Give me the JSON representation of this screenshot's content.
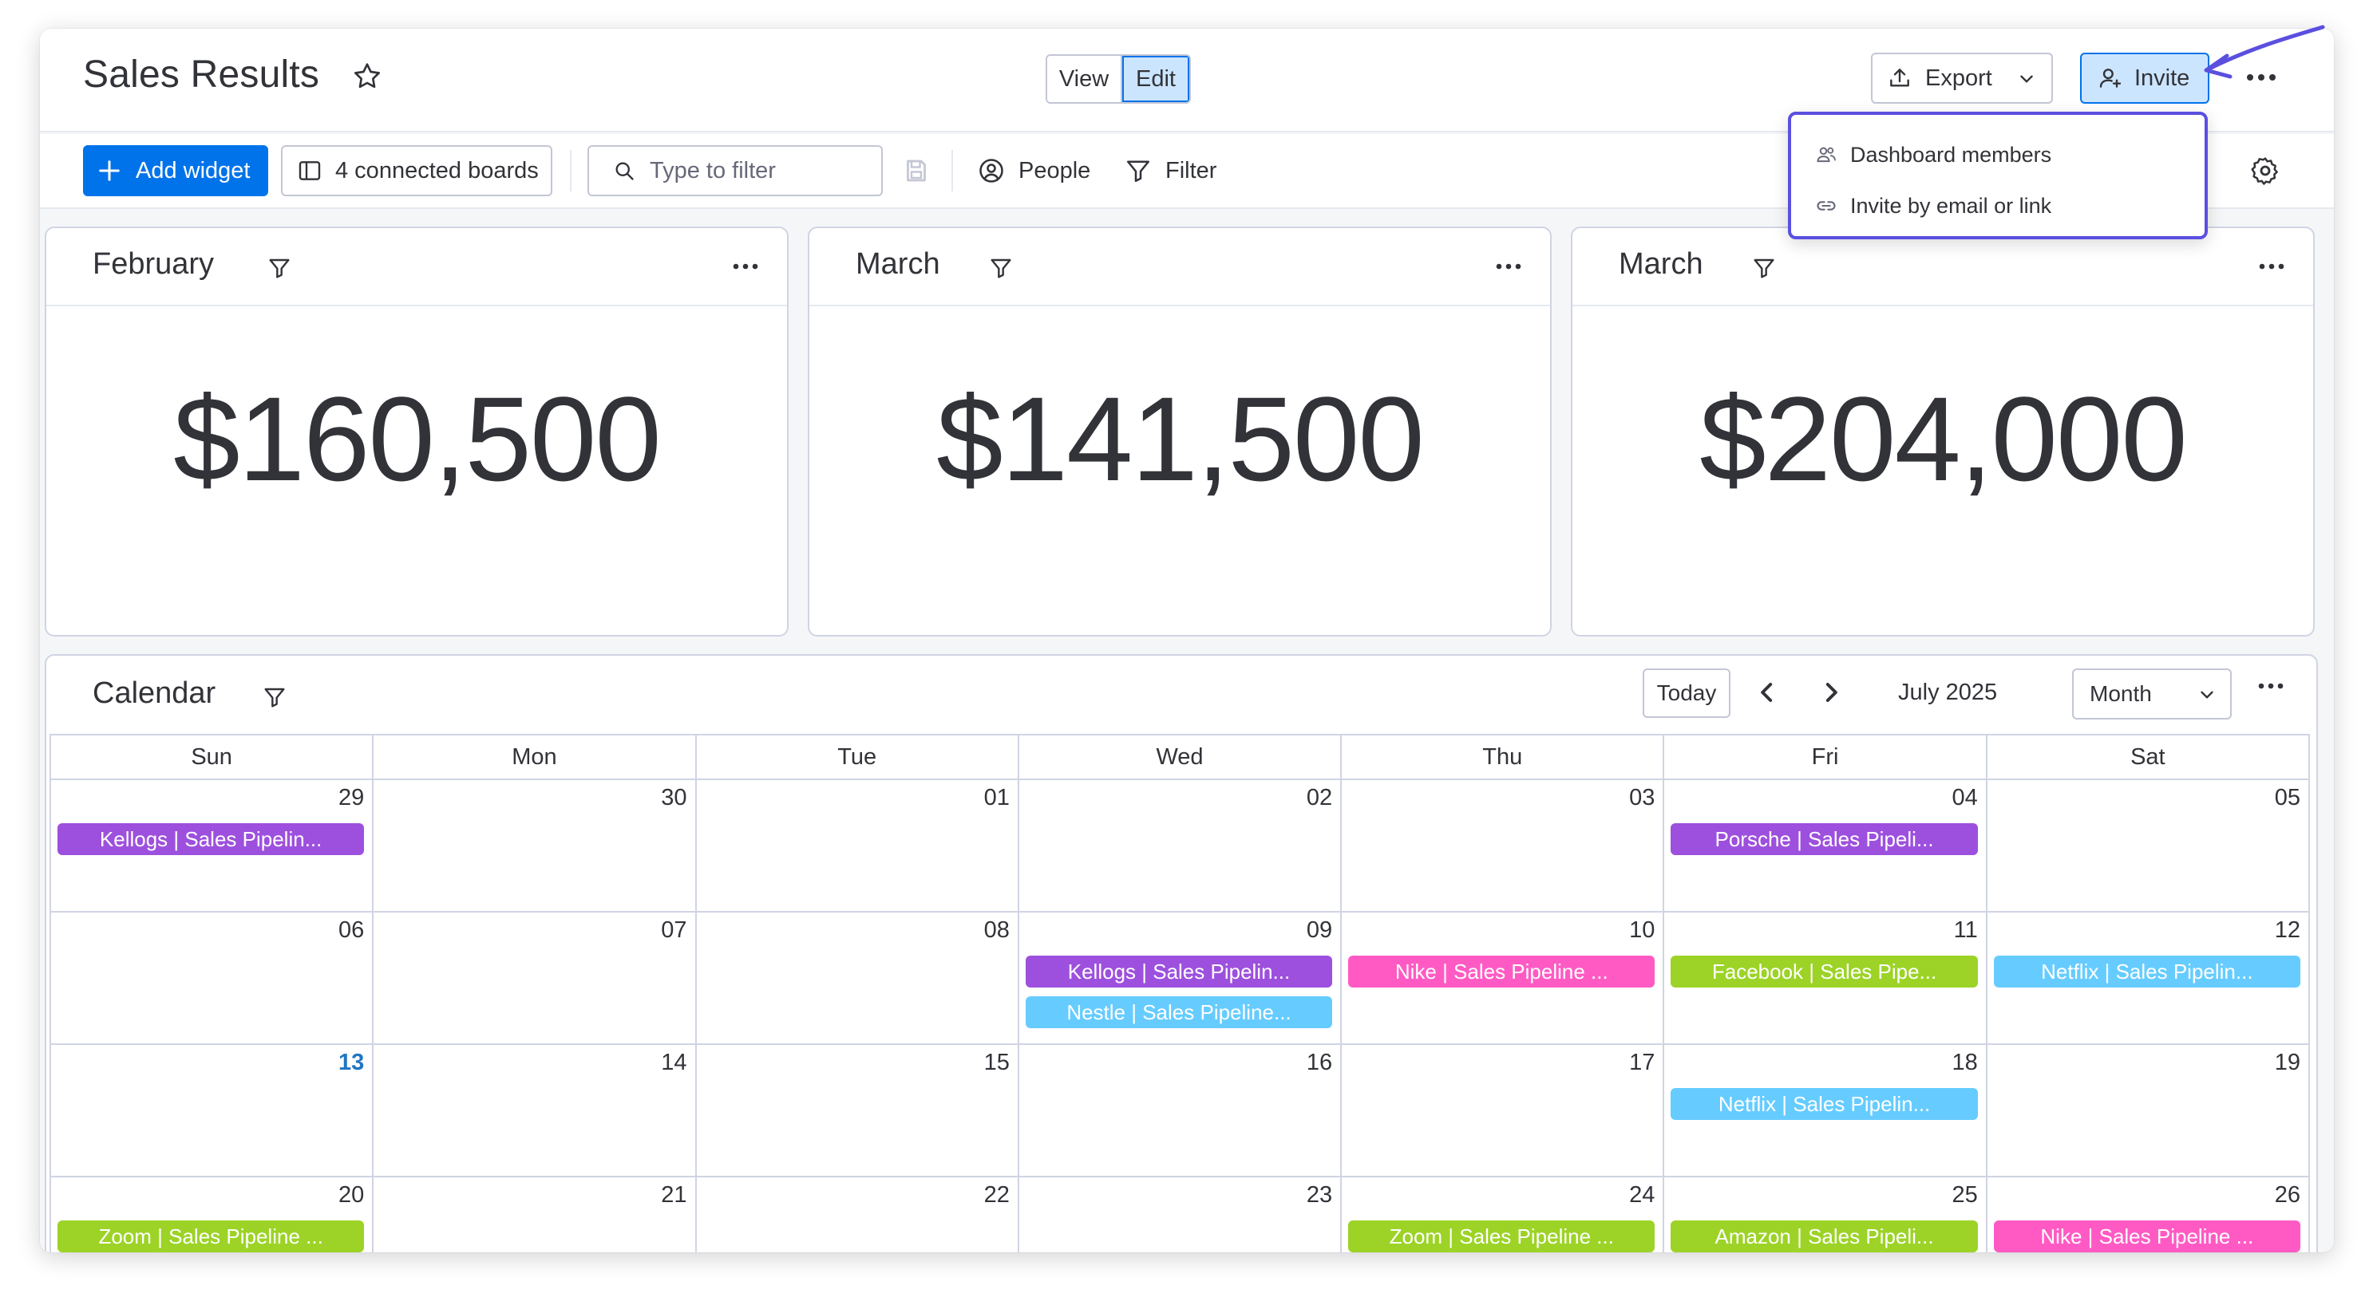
{
  "header": {
    "title": "Sales Results",
    "view_label": "View",
    "edit_label": "Edit",
    "export_label": "Export",
    "invite_label": "Invite"
  },
  "toolbar": {
    "add_widget_label": "Add widget",
    "connected_boards_label": "4 connected boards",
    "filter_placeholder": "Type to filter",
    "people_label": "People",
    "filter_label": "Filter"
  },
  "invite_menu": {
    "items": [
      {
        "label": "Dashboard members",
        "icon": "members-icon"
      },
      {
        "label": "Invite by email or link",
        "icon": "link-icon"
      }
    ]
  },
  "cards": [
    {
      "title": "February",
      "value": "$160,500"
    },
    {
      "title": "March",
      "value": "$141,500"
    },
    {
      "title": "March",
      "value": "$204,000"
    }
  ],
  "calendar": {
    "title": "Calendar",
    "today_label": "Today",
    "month_label": "July 2025",
    "view_select": "Month",
    "weekdays": [
      "Sun",
      "Mon",
      "Tue",
      "Wed",
      "Thu",
      "Fri",
      "Sat"
    ],
    "colors": {
      "purple": "#9d50dd",
      "pink": "#ff5ac4",
      "green": "#9cd326",
      "blue": "#66ccff"
    },
    "weeks": [
      [
        {
          "day": "29",
          "events": [
            {
              "label": "Kellogs | Sales Pipelin...",
              "color": "purple"
            }
          ]
        },
        {
          "day": "30",
          "events": []
        },
        {
          "day": "01",
          "events": []
        },
        {
          "day": "02",
          "events": []
        },
        {
          "day": "03",
          "events": []
        },
        {
          "day": "04",
          "events": [
            {
              "label": "Porsche | Sales Pipeli...",
              "color": "purple"
            }
          ]
        },
        {
          "day": "05",
          "events": []
        }
      ],
      [
        {
          "day": "06",
          "events": []
        },
        {
          "day": "07",
          "events": []
        },
        {
          "day": "08",
          "events": []
        },
        {
          "day": "09",
          "events": [
            {
              "label": "Kellogs | Sales Pipelin...",
              "color": "purple"
            },
            {
              "label": "Nestle | Sales Pipeline...",
              "color": "blue"
            }
          ]
        },
        {
          "day": "10",
          "events": [
            {
              "label": "Nike | Sales Pipeline ...",
              "color": "pink"
            }
          ]
        },
        {
          "day": "11",
          "events": [
            {
              "label": "Facebook | Sales Pipe...",
              "color": "green"
            }
          ]
        },
        {
          "day": "12",
          "events": [
            {
              "label": "Netflix | Sales Pipelin...",
              "color": "blue"
            }
          ]
        }
      ],
      [
        {
          "day": "13",
          "today": true,
          "events": []
        },
        {
          "day": "14",
          "events": []
        },
        {
          "day": "15",
          "events": []
        },
        {
          "day": "16",
          "events": []
        },
        {
          "day": "17",
          "events": []
        },
        {
          "day": "18",
          "events": [
            {
              "label": "Netflix | Sales Pipelin...",
              "color": "blue"
            }
          ]
        },
        {
          "day": "19",
          "events": []
        }
      ],
      [
        {
          "day": "20",
          "events": [
            {
              "label": "Zoom | Sales Pipeline ...",
              "color": "green"
            }
          ]
        },
        {
          "day": "21",
          "events": []
        },
        {
          "day": "22",
          "events": []
        },
        {
          "day": "23",
          "events": []
        },
        {
          "day": "24",
          "events": [
            {
              "label": "Zoom | Sales Pipeline ...",
              "color": "green"
            }
          ]
        },
        {
          "day": "25",
          "events": [
            {
              "label": "Amazon | Sales Pipeli...",
              "color": "green"
            }
          ]
        },
        {
          "day": "26",
          "events": [
            {
              "label": "Nike | Sales Pipeline ...",
              "color": "pink"
            }
          ]
        }
      ]
    ]
  },
  "accent_color": "#0073ea",
  "annotation_color": "#5b4fe0"
}
